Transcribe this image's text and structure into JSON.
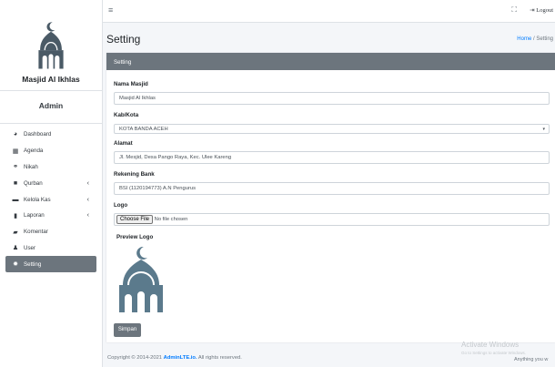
{
  "sidebar": {
    "brand": "Masjid Al Ikhlas",
    "user": "Admin",
    "items": [
      {
        "label": "Dashboard",
        "icon": "tachometer-icon"
      },
      {
        "label": "Agenda",
        "icon": "calendar-icon"
      },
      {
        "label": "Nikah",
        "icon": "rings-icon"
      },
      {
        "label": "Qurban",
        "icon": "box-icon"
      },
      {
        "label": "Kelola Kas",
        "icon": "money-icon"
      },
      {
        "label": "Laporan",
        "icon": "file-icon"
      },
      {
        "label": "Komentar",
        "icon": "comment-icon"
      },
      {
        "label": "User",
        "icon": "users-icon"
      },
      {
        "label": "Setting",
        "icon": "gear-icon"
      }
    ]
  },
  "topbar": {
    "menu_icon": "≡",
    "expand_icon": "⛶",
    "logout": "Logout"
  },
  "page": {
    "title": "Setting",
    "breadcrumb_home": "Home",
    "breadcrumb_sep": " / ",
    "breadcrumb_current": "Setting"
  },
  "card": {
    "title": "Setting"
  },
  "form": {
    "nama_label": "Nama Masjid",
    "nama_value": "Masjid Al Ikhlas",
    "kota_label": "Kab/Kota",
    "kota_value": "KOTA BANDA ACEH",
    "alamat_label": "Alamat",
    "alamat_value": "Jl. Mesjid, Desa Pango Raya, Kec. Ulee Kareng",
    "rekening_label": "Rekening Bank",
    "rekening_value": "BSI (1120194773) A.N Pengurus",
    "logo_label": "Logo",
    "file_button": "Choose File",
    "file_status": "No file chosen",
    "preview_label": "Preview Logo",
    "save_button": "Simpan"
  },
  "footer": {
    "prefix": "Copyright © 2014-2021 ",
    "link": "AdminLTE.io.",
    "suffix": " All rights reserved."
  },
  "watermark": {
    "title": "Activate Windows",
    "subtitle": "Go to Settings to activate Windows.",
    "extra": "Anything you w"
  },
  "colors": {
    "accent": "#6c757d",
    "link": "#007bff",
    "background": "#f4f6f9"
  }
}
